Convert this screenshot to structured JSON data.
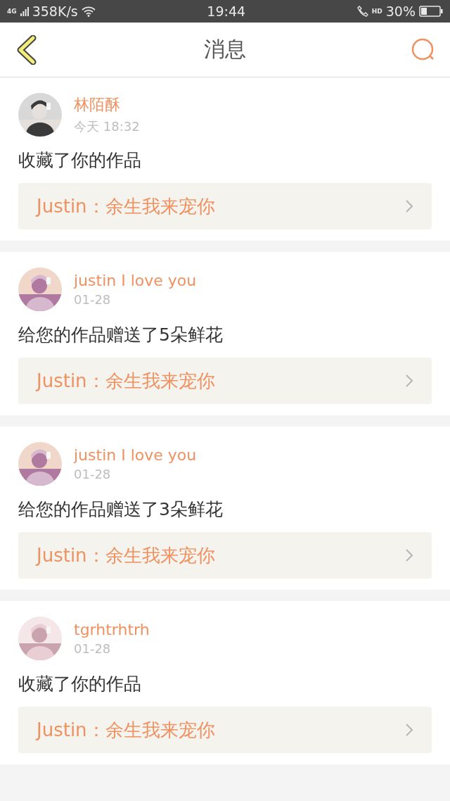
{
  "status_bar": {
    "network": "4G",
    "speed": "358K/s",
    "time": "19:44",
    "hd": "HD",
    "battery": "30%"
  },
  "header": {
    "title": "消息"
  },
  "messages": [
    {
      "name": "林陌酥",
      "time": "今天 18:32",
      "text": "收藏了你的作品",
      "quote": "Justin：余生我来宠你"
    },
    {
      "name": "justin I love you",
      "time": "01-28",
      "text": "给您的作品赠送了5朵鲜花",
      "quote": "Justin：余生我来宠你"
    },
    {
      "name": "justin I love you",
      "time": "01-28",
      "text": "给您的作品赠送了3朵鲜花",
      "quote": "Justin：余生我来宠你"
    },
    {
      "name": "tgrhtrhtrh",
      "time": "01-28",
      "text": "收藏了你的作品",
      "quote": "Justin：余生我来宠你"
    }
  ]
}
